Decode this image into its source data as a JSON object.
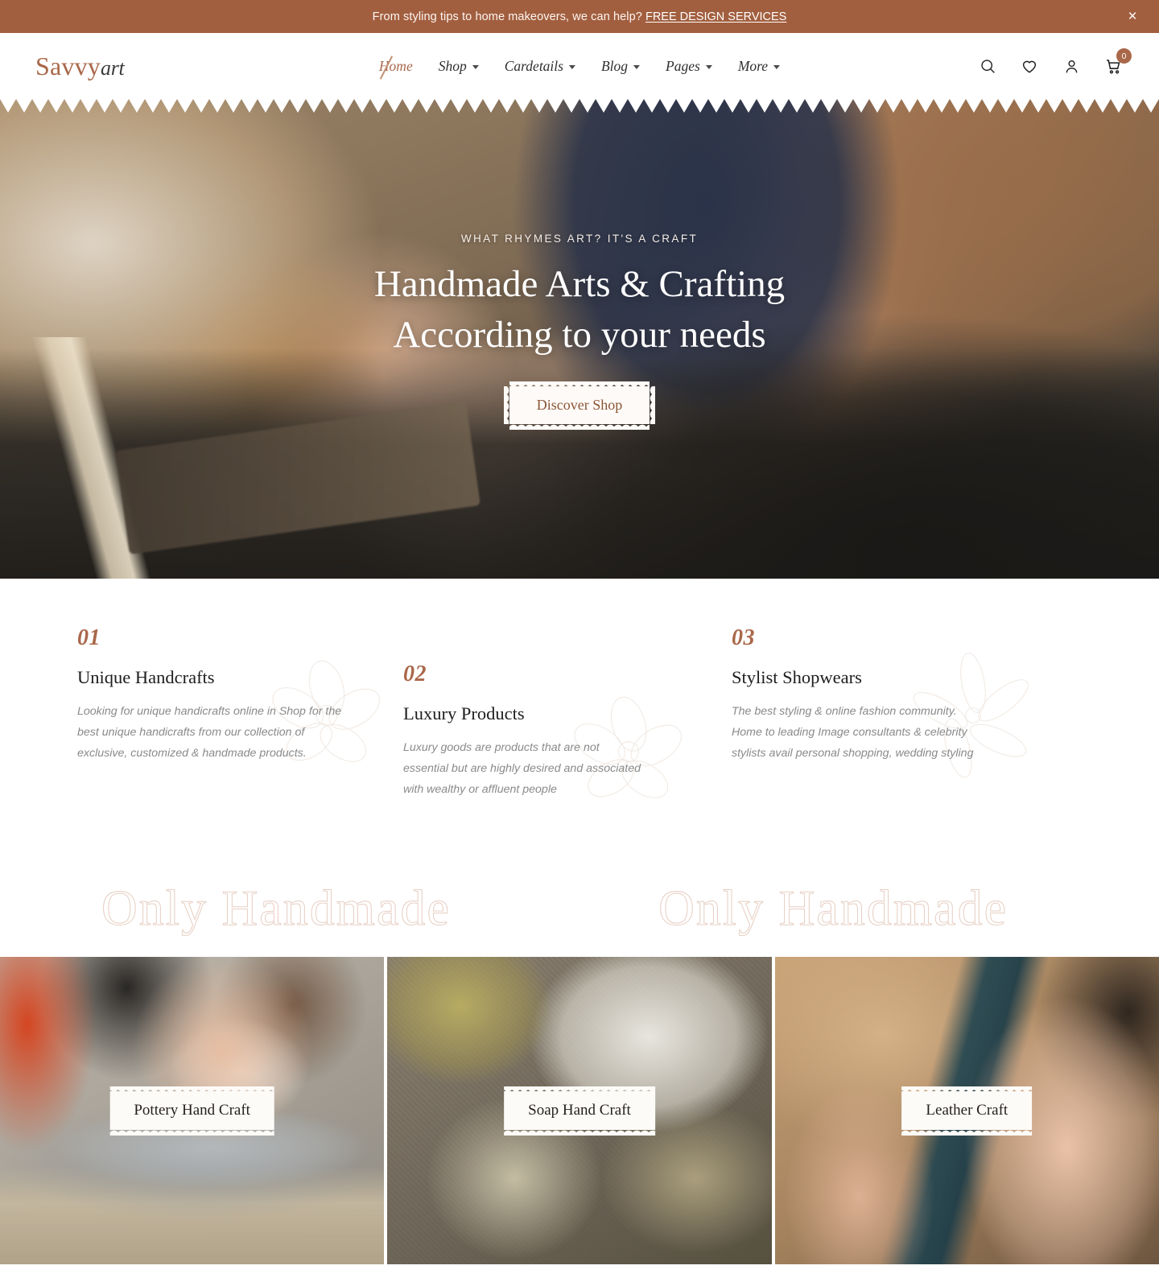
{
  "promo": {
    "text": "From styling tips to home makeovers, we can help?",
    "link_label": "FREE DESIGN SERVICES",
    "close_label": "×",
    "background_color": "#a25f3f"
  },
  "header": {
    "logo_main": "Savvy",
    "logo_sub": "art",
    "nav": [
      {
        "label": "Home",
        "has_caret": false,
        "active": true
      },
      {
        "label": "Shop",
        "has_caret": true,
        "active": false
      },
      {
        "label": "Cardetails",
        "has_caret": true,
        "active": false
      },
      {
        "label": "Blog",
        "has_caret": true,
        "active": false
      },
      {
        "label": "Pages",
        "has_caret": true,
        "active": false
      },
      {
        "label": "More",
        "has_caret": true,
        "active": false
      }
    ],
    "actions": {
      "search_icon": "search-icon",
      "wishlist_icon": "heart-icon",
      "account_icon": "user-icon",
      "cart_icon": "cart-icon",
      "cart_count": "0"
    },
    "accent_color": "#a9684a"
  },
  "hero": {
    "eyebrow": "WHAT RHYMES ART? IT'S A CRAFT",
    "title_line1": "Handmade Arts & Crafting",
    "title_line2": "According to your needs",
    "cta_label": "Discover Shop"
  },
  "features": [
    {
      "number": "01",
      "title": "Unique Handcrafts",
      "description": "Looking for unique handicrafts online in Shop for the best unique handicrafts from our collection of exclusive, customized & handmade products."
    },
    {
      "number": "02",
      "title": "Luxury Products",
      "description": "Luxury goods are products that are not essential but are highly desired and associated with wealthy or affluent people"
    },
    {
      "number": "03",
      "title": "Stylist Shopwears",
      "description": "The best styling & online fashion community. Home to leading Image consultants & celebrity stylists avail personal shopping, wedding styling"
    }
  ],
  "marquee": {
    "words": [
      "Only Handmade",
      "Only Handmade"
    ],
    "outline_color": "#e7cfc3"
  },
  "categories": [
    {
      "label": "Pottery Hand Craft"
    },
    {
      "label": "Soap Hand Craft"
    },
    {
      "label": "Leather Craft"
    }
  ]
}
